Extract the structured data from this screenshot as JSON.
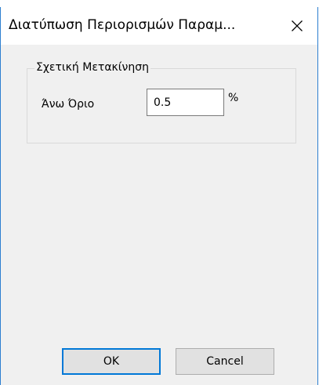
{
  "window": {
    "title": "Διατύπωση Περιορισμών Παραμ...",
    "close_glyph": "✕"
  },
  "group": {
    "legend": "Σχετική Μετακίνηση",
    "field_label": "Άνω Όριο",
    "field_value": "0.5",
    "unit": "%"
  },
  "buttons": {
    "ok_label": "OK",
    "cancel_label": "Cancel"
  },
  "colors": {
    "accent": "#0078d7",
    "window_border": "#2d7fd0",
    "client_bg": "#f0f0f0",
    "button_bg": "#e1e1e1"
  }
}
